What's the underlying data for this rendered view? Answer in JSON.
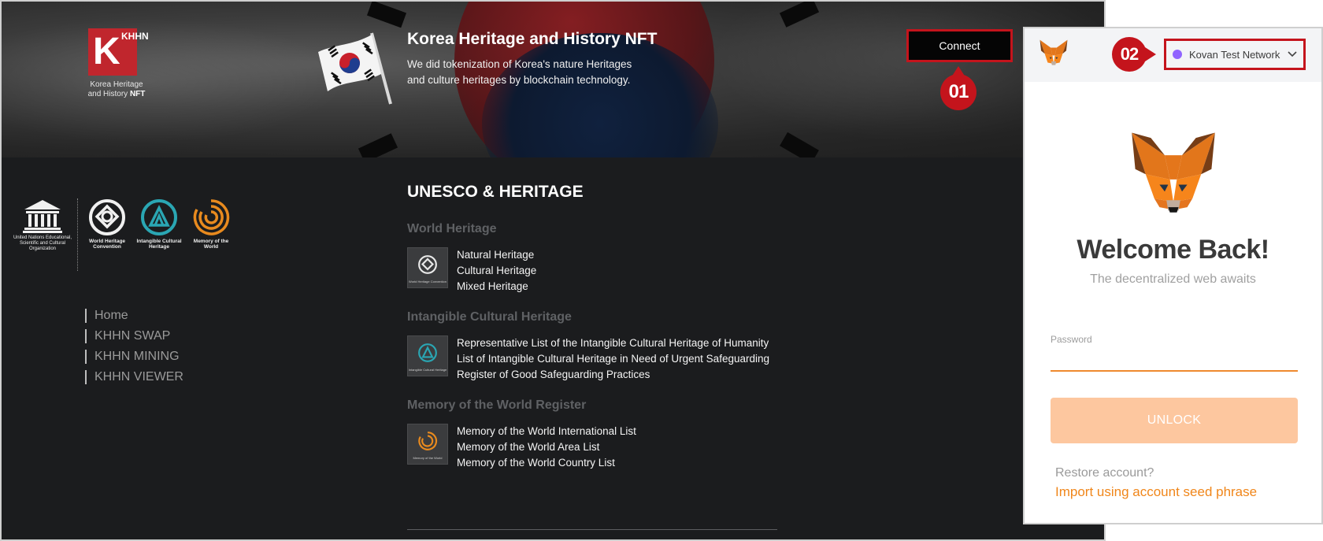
{
  "site": {
    "logo": {
      "mark": "K",
      "stack": "KHHN",
      "line1": "Korea Heritage",
      "line2": "and History ",
      "line2_bold": "NFT"
    },
    "hero": {
      "title": "Korea Heritage and History NFT",
      "description": "We did tokenization of Korea's nature Heritages and culture heritages by blockchain technology."
    },
    "connect_label": "Connect",
    "marker1": "01",
    "partners": [
      {
        "name": "unesco-logo",
        "text": "United Nations Educational, Scientific and Cultural Organization"
      },
      {
        "name": "world-heritage-logo",
        "text": "World Heritage Convention"
      },
      {
        "name": "intangible-heritage-logo",
        "text": "Intangible Cultural Heritage"
      },
      {
        "name": "memory-of-world-logo",
        "text": "Memory of the World"
      }
    ],
    "nav": [
      "Home",
      "KHHN SWAP",
      "KHHN MINING",
      "KHHN VIEWER"
    ],
    "section_title": "UNESCO & HERITAGE",
    "categories": [
      {
        "title": "World Heritage",
        "icon_text": "World Heritage Convention",
        "items": [
          "Natural Heritage",
          "Cultural Heritage",
          "Mixed Heritage"
        ]
      },
      {
        "title": "Intangible Cultural Heritage",
        "icon_text": "Intangible Cultural Heritage",
        "items": [
          "Representative List of the Intangible Cultural Heritage of Humanity",
          "List of Intangible Cultural Heritage in Need of Urgent Safeguarding",
          "Register of Good Safeguarding Practices"
        ]
      },
      {
        "title": "Memory of the World Register",
        "icon_text": "Memory of the World",
        "items": [
          "Memory of the World International List",
          "Memory of the World Area List",
          "Memory of the World Country List"
        ]
      }
    ]
  },
  "metamask": {
    "marker2": "02",
    "network": "Kovan Test Network",
    "welcome": "Welcome Back!",
    "tagline": "The decentralized web awaits",
    "password_label": "Password",
    "password_value": "",
    "unlock_label": "UNLOCK",
    "restore_text": "Restore account?",
    "import_link": "Import using account seed phrase"
  },
  "colors": {
    "marker_red": "#c4141c",
    "metamask_orange": "#f0861a",
    "unlock_disabled": "#fdc79f",
    "network_dot": "#9064ff",
    "site_bg": "#1b1c1e"
  }
}
